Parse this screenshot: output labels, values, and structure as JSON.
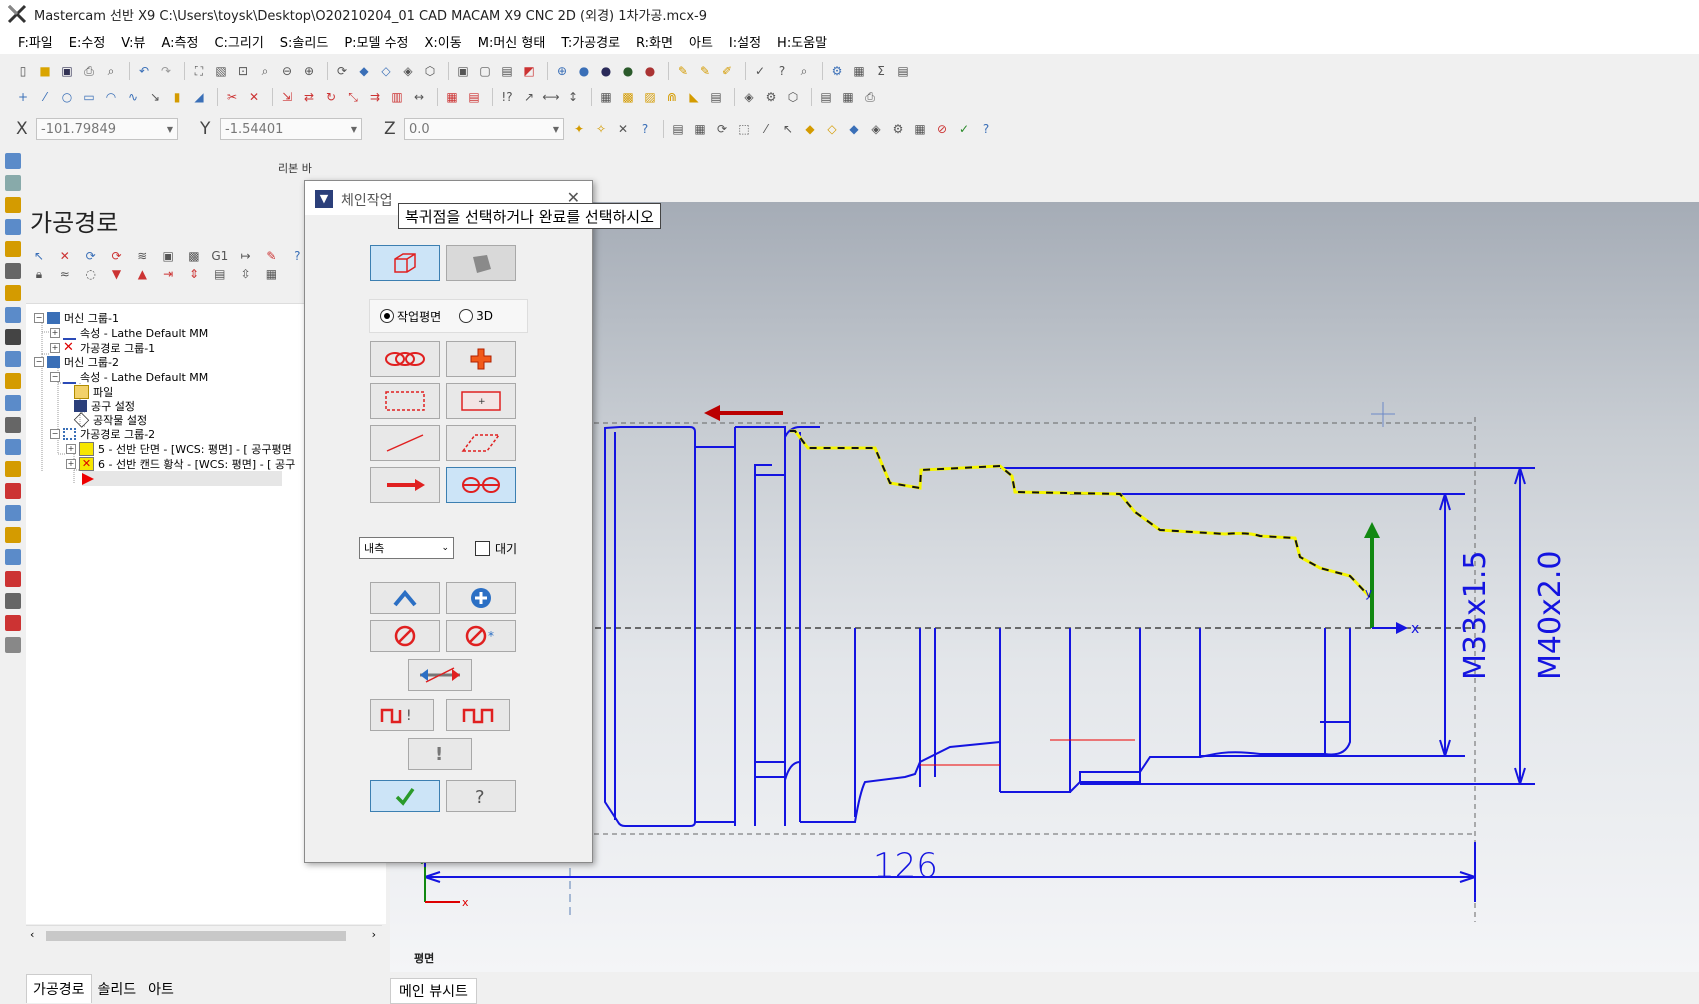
{
  "window": {
    "title": "Mastercam 선반 X9  C:\\Users\\toysk\\Desktop\\O20210204_01 CAD MACAM X9 CNC 2D (외경) 1차가공.mcx-9"
  },
  "menu": [
    "F:파일",
    "E:수정",
    "V:뷰",
    "A:측정",
    "C:그리기",
    "S:솔리드",
    "P:모델 수정",
    "X:이동",
    "M:머신 형태",
    "T:가공경로",
    "R:화면",
    "아트",
    "I:설정",
    "H:도움말"
  ],
  "coords": {
    "x_label": "X",
    "x_value": "-101.79849",
    "y_label": "Y",
    "y_value": "-1.54401",
    "z_label": "Z",
    "z_value": "0.0"
  },
  "ribbon_label": "리본 바",
  "panel": {
    "title": "가공경로",
    "tree": [
      "머신 그룹-1",
      "속성 - Lathe Default MM",
      "가공경로 그룹-1",
      "머신 그룹-2",
      "속성 - Lathe Default MM",
      "파일",
      "공구 설정",
      "공작물 설정",
      "가공경로 그룹-2",
      "5 - 선반 단면 - [WCS: 평면] - [  공구평면",
      "6 - 선반 캔드 황삭 - [WCS: 평면] - [  공구"
    ]
  },
  "bottom_tabs": [
    "가공경로",
    "솔리드",
    "아트"
  ],
  "viewport": {
    "view_label": "평면",
    "main_tab": "메인 뷰시트",
    "dim_length": "126",
    "dim_d1": "M33x1.5",
    "dim_d2": "M40x2.0",
    "axis_x": "x",
    "axis_y": "y"
  },
  "tooltip": "복귀점을 선택하거나 완료를 선택하시오",
  "dialog": {
    "title": "체인작업",
    "radio_plane": "작업평면",
    "radio_3d": "3D",
    "select_value": "내측",
    "wait_label": "대기"
  }
}
